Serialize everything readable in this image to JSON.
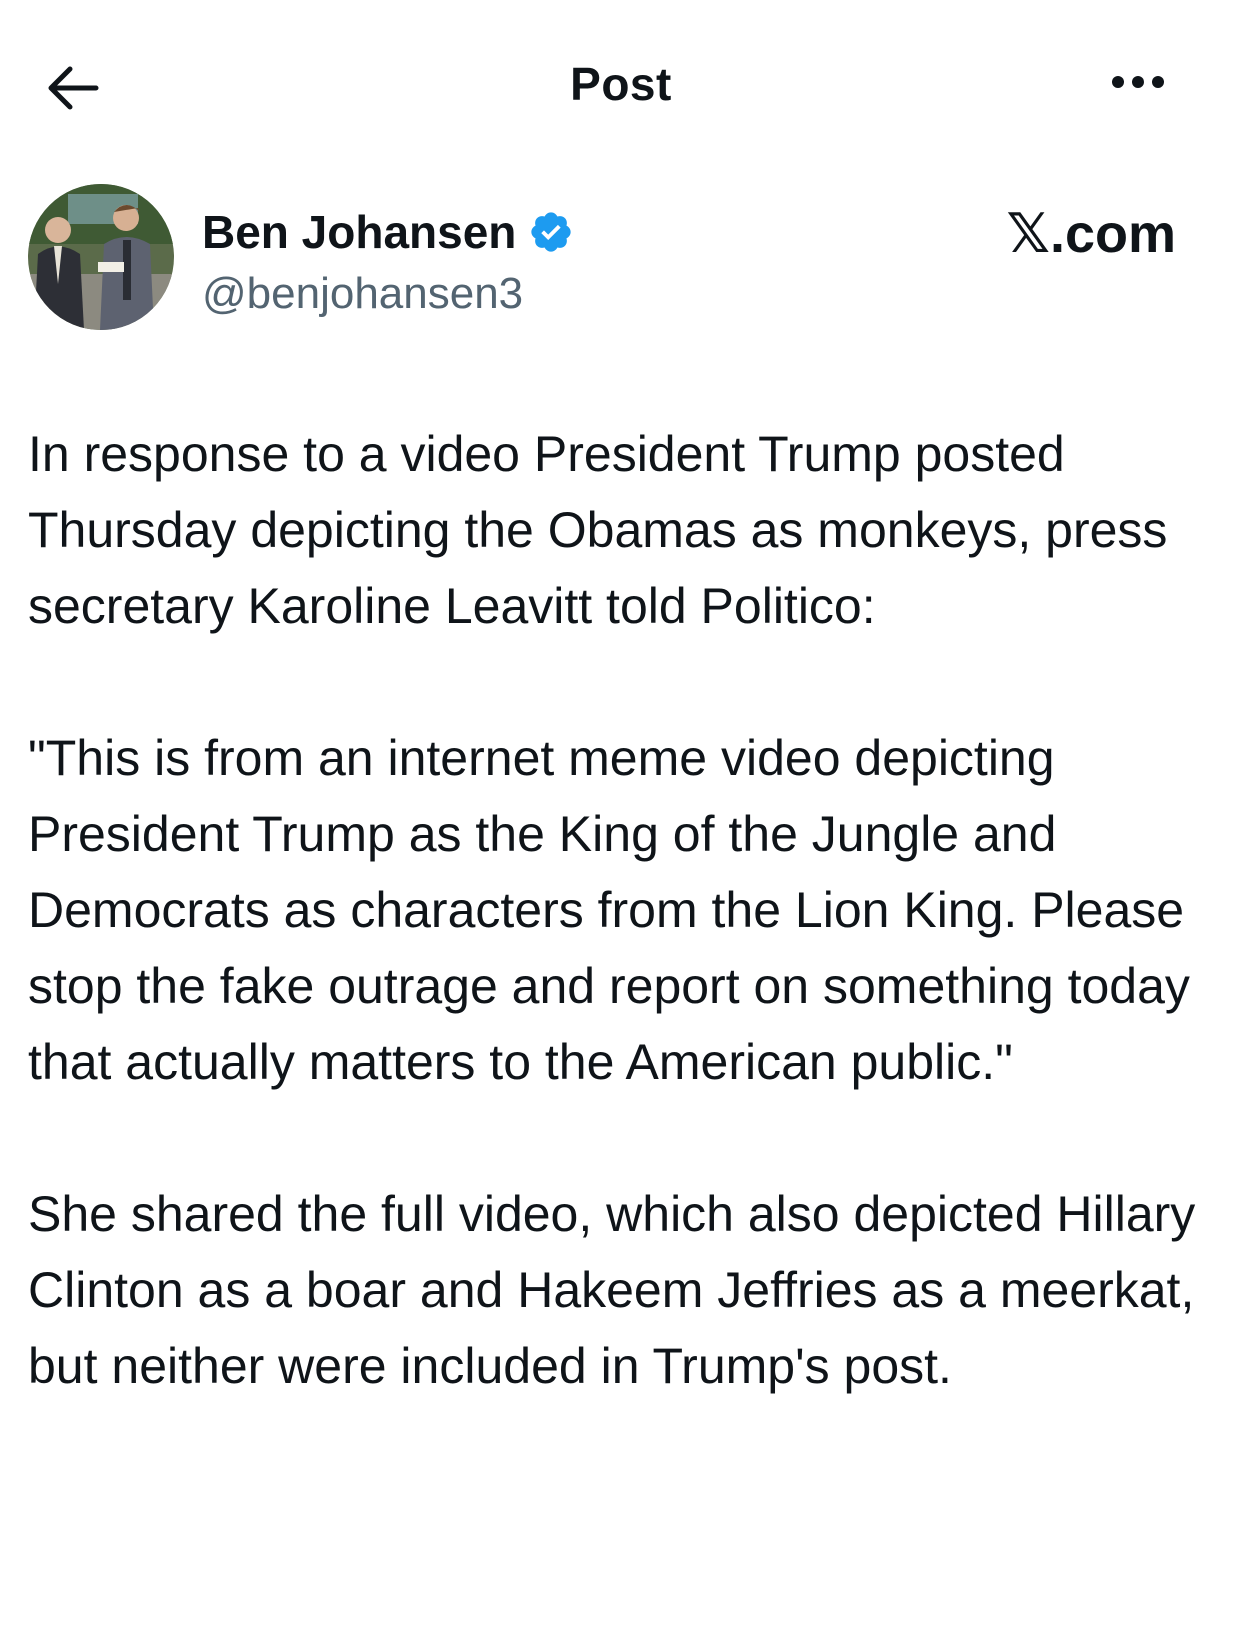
{
  "header": {
    "title": "Post",
    "back_icon": "arrow-left-icon",
    "more_icon": "more-horizontal-icon"
  },
  "author": {
    "name": "Ben Johansen",
    "handle": "@benjohansen3",
    "verified": true,
    "verified_color": "#1d9bf0"
  },
  "source": "𝕏.com",
  "post": {
    "paragraphs": [
      "In response to a video President Trump posted Thursday depicting the Obamas as monkeys, press secretary Karoline Leavitt told Politico:",
      "\"This is from an internet meme video depicting President Trump as the King of the Jungle and Democrats as characters from the Lion King. Please stop the fake outrage and report on something today that actually matters to the American public.\"",
      "She shared the full video, which also depicted Hillary Clinton as a boar and Hakeem Jeffries as a meerkat, but neither were included in Trump's post."
    ]
  }
}
